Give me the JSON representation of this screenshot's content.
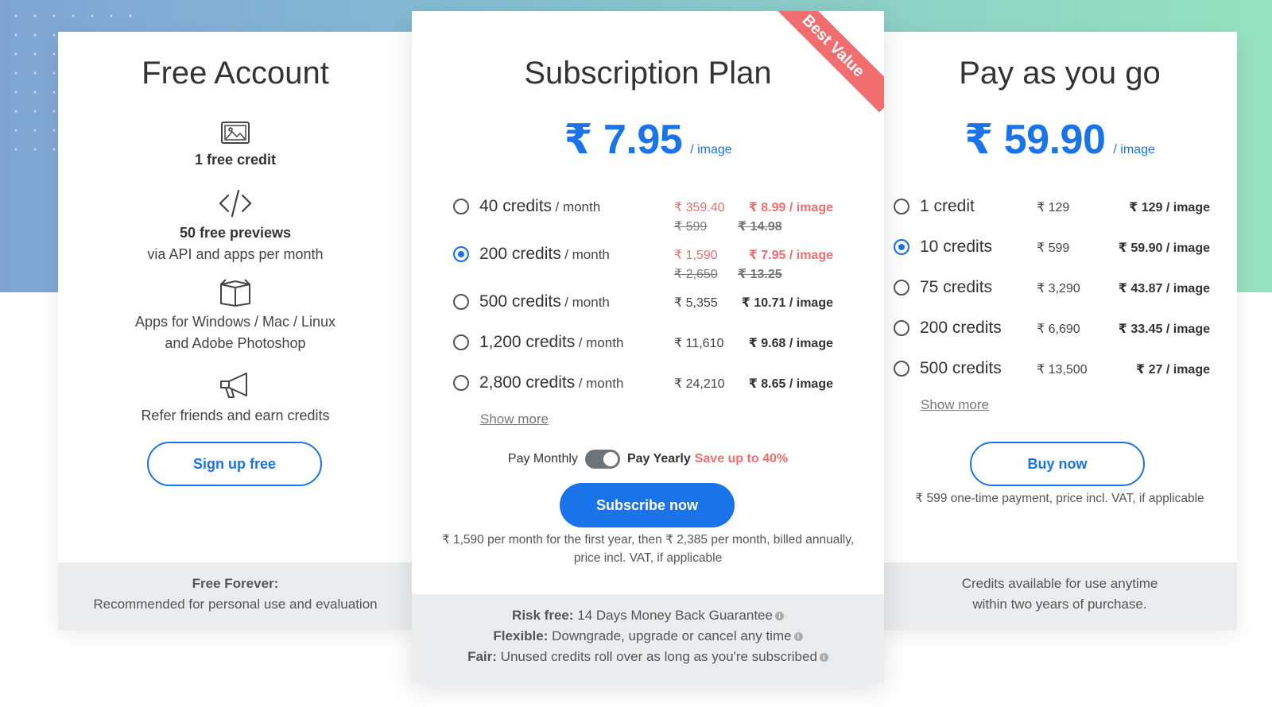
{
  "free": {
    "title": "Free Account",
    "feature1": "1 free credit",
    "feature2_bold": "50 free previews",
    "feature2_sub": "via API and apps per month",
    "feature3_line1": "Apps for Windows / Mac / Linux",
    "feature3_line2": "and Adobe Photoshop",
    "feature4": "Refer friends and earn credits",
    "button": "Sign up free",
    "footer_bold": "Free Forever:",
    "footer_text": "Recommended for personal use and evaluation"
  },
  "subscription": {
    "title": "Subscription Plan",
    "ribbon": "Best Value",
    "price": "₹ 7.95",
    "price_unit": "/ image",
    "rows": [
      {
        "credits": "40 credits",
        "period": "/ month",
        "price": "₹ 359.40",
        "per_image": "₹ 8.99 / image",
        "old_price": "₹ 599",
        "old_per_image": "₹ 14.98",
        "selected": false,
        "discount": true
      },
      {
        "credits": "200 credits",
        "period": "/ month",
        "price": "₹ 1,590",
        "per_image": "₹ 7.95 / image",
        "old_price": "₹ 2,650",
        "old_per_image": "₹ 13.25",
        "selected": true,
        "discount": true
      },
      {
        "credits": "500 credits",
        "period": "/ month",
        "price": "₹ 5,355",
        "per_image": "₹ 10.71 / image",
        "selected": false,
        "discount": false
      },
      {
        "credits": "1,200 credits",
        "period": "/ month",
        "price": "₹ 11,610",
        "per_image": "₹ 9.68 / image",
        "selected": false,
        "discount": false
      },
      {
        "credits": "2,800 credits",
        "period": "/ month",
        "price": "₹ 24,210",
        "per_image": "₹ 8.65 / image",
        "selected": false,
        "discount": false
      }
    ],
    "show_more": "Show more",
    "toggle_monthly": "Pay Monthly",
    "toggle_yearly": "Pay Yearly",
    "save": "Save up to 40%",
    "button": "Subscribe now",
    "fine_line1": "₹ 1,590 per month for the first year, then ₹ 2,385 per month, billed annually,",
    "fine_line2": "price incl. VAT, if applicable",
    "footer": [
      {
        "bold": "Risk free:",
        "text": "14 Days Money Back Guarantee"
      },
      {
        "bold": "Flexible:",
        "text": "Downgrade, upgrade or cancel any time"
      },
      {
        "bold": "Fair:",
        "text": "Unused credits roll over as long as you're subscribed"
      }
    ]
  },
  "payg": {
    "title": "Pay as you go",
    "price": "₹ 59.90",
    "price_unit": "/ image",
    "rows": [
      {
        "credits": "1 credit",
        "price": "₹ 129",
        "per_image": "₹ 129 / image",
        "selected": false
      },
      {
        "credits": "10 credits",
        "price": "₹ 599",
        "per_image": "₹ 59.90 / image",
        "selected": true
      },
      {
        "credits": "75 credits",
        "price": "₹ 3,290",
        "per_image": "₹ 43.87 / image",
        "selected": false
      },
      {
        "credits": "200 credits",
        "price": "₹ 6,690",
        "per_image": "₹ 33.45 / image",
        "selected": false
      },
      {
        "credits": "500 credits",
        "price": "₹ 13,500",
        "per_image": "₹ 27 / image",
        "selected": false
      }
    ],
    "show_more": "Show more",
    "button": "Buy now",
    "fine": "₹ 599 one-time payment, price incl. VAT, if applicable",
    "footer_line1": "Credits available for use anytime",
    "footer_line2": "within two years of purchase."
  },
  "colors": {
    "accent": "#1a73e8",
    "discount": "#f26d6d"
  }
}
